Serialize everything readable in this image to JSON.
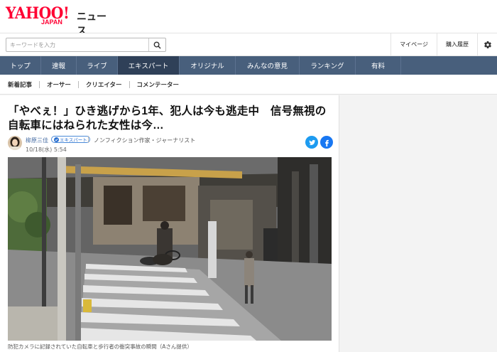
{
  "header": {
    "logo_yahoo": "YAHOO!",
    "logo_japan": "JAPAN",
    "logo_news": "ニュース"
  },
  "search": {
    "placeholder": "キーワードを入力",
    "button_icon": "search-icon"
  },
  "header_links": {
    "mypage": "マイページ",
    "history": "購入履歴",
    "settings_icon": "gear-icon"
  },
  "nav": {
    "tabs": [
      {
        "label": "トップ"
      },
      {
        "label": "速報"
      },
      {
        "label": "ライブ"
      },
      {
        "label": "エキスパート"
      },
      {
        "label": "オリジナル"
      },
      {
        "label": "みんなの意見"
      },
      {
        "label": "ランキング"
      },
      {
        "label": "有料"
      }
    ],
    "active_index": 3
  },
  "subnav": {
    "items": [
      {
        "label": "新着記事"
      },
      {
        "label": "オーサー"
      },
      {
        "label": "クリエイター"
      },
      {
        "label": "コメンテーター"
      }
    ]
  },
  "article": {
    "title": "「やべぇ！」ひき逃げから1年、犯人は今も逃走中　信号無視の自転車にはねられた女性は今…",
    "author": {
      "name": "柳原三佳",
      "badge": "エキスパート",
      "profile": "ノンフィクション作家・ジャーナリスト",
      "date": "10/18(水) 5:54"
    },
    "share_icons": [
      "twitter-icon",
      "facebook-icon"
    ],
    "photo_caption": "防犯カメラに記録されていた自転車と歩行者の衝突事故の瞬間（Aさん提供）"
  },
  "colors": {
    "nav_bg": "#485f7c",
    "nav_active": "#2f4058",
    "brand_red": "#ff0033",
    "twitter": "#1d9bf0",
    "facebook": "#1877f2"
  }
}
